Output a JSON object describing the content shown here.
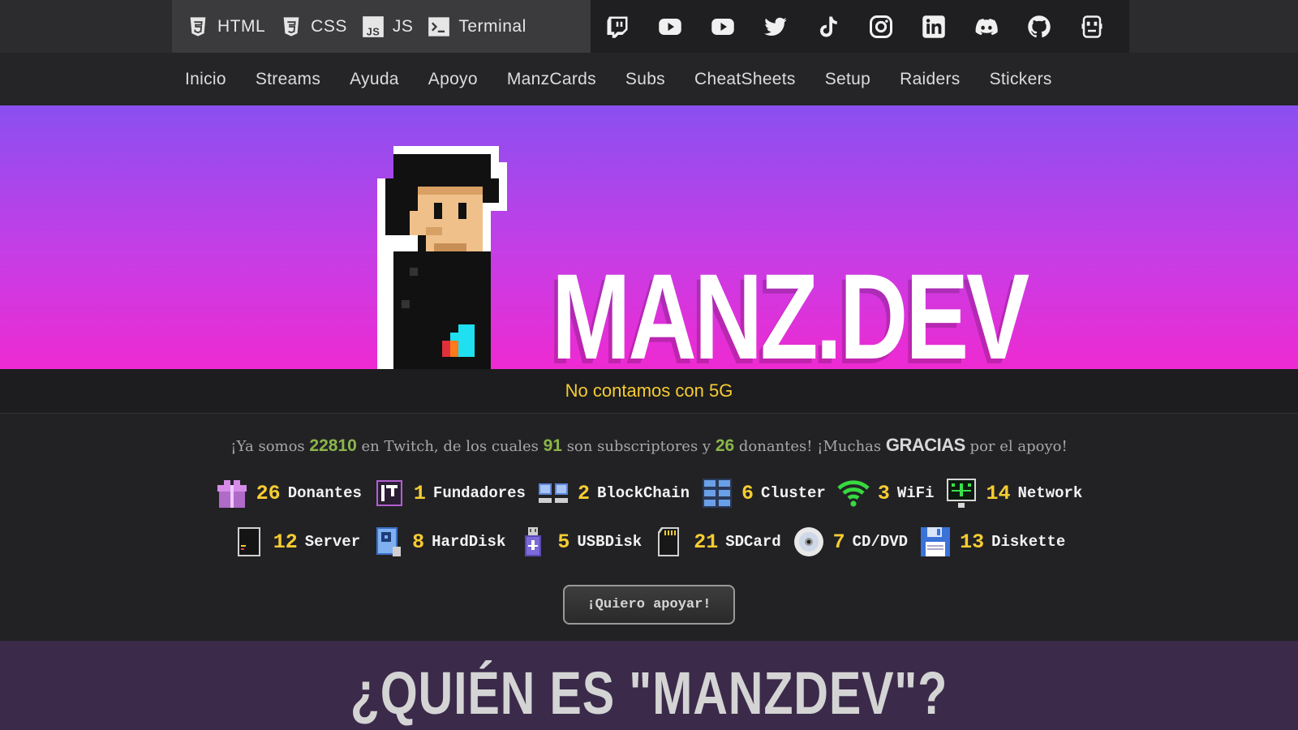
{
  "topbar": {
    "links": [
      {
        "label": "HTML",
        "icon": "html5-icon"
      },
      {
        "label": "CSS",
        "icon": "css3-icon"
      },
      {
        "label": "JS",
        "icon": "js-icon"
      },
      {
        "label": "Terminal",
        "icon": "terminal-icon"
      }
    ],
    "social": [
      "twitch-icon",
      "youtube-icon",
      "youtube-icon",
      "twitter-icon",
      "tiktok-icon",
      "instagram-icon",
      "linkedin-icon",
      "discord-icon",
      "github-icon",
      "manz-icon"
    ]
  },
  "nav": {
    "items": [
      "Inicio",
      "Streams",
      "Ayuda",
      "Apoyo",
      "ManzCards",
      "Subs",
      "CheatSheets",
      "Setup",
      "Raiders",
      "Stickers"
    ]
  },
  "hero": {
    "brand": "MANZ.DEV"
  },
  "banner": {
    "text": "No contamos con 5G"
  },
  "stats": {
    "p1": "¡Ya somos ",
    "followers": "22810",
    "p2": " en Twitch, de los cuales ",
    "subs": "91",
    "p3": " son subscriptores y ",
    "donors": "26",
    "p4": " donantes! ¡Muchas ",
    "thanks": "GRACIAS",
    "p5": " por el apoyo!"
  },
  "tiers_row1": [
    {
      "count": "26",
      "name": "Donantes",
      "icon": "gift-icon"
    },
    {
      "count": "1",
      "name": "Fundadores",
      "icon": "first-badge-icon"
    },
    {
      "count": "2",
      "name": "BlockChain",
      "icon": "blockchain-icon"
    },
    {
      "count": "6",
      "name": "Cluster",
      "icon": "cluster-icon"
    },
    {
      "count": "3",
      "name": "WiFi",
      "icon": "wifi-icon"
    },
    {
      "count": "14",
      "name": "Network",
      "icon": "network-icon"
    }
  ],
  "tiers_row2": [
    {
      "count": "12",
      "name": "Server",
      "icon": "server-icon"
    },
    {
      "count": "8",
      "name": "HardDisk",
      "icon": "harddisk-icon"
    },
    {
      "count": "5",
      "name": "USBDisk",
      "icon": "usb-icon"
    },
    {
      "count": "21",
      "name": "SDCard",
      "icon": "sdcard-icon"
    },
    {
      "count": "7",
      "name": "CD/DVD",
      "icon": "cd-icon"
    },
    {
      "count": "13",
      "name": "Diskette",
      "icon": "diskette-icon"
    }
  ],
  "support_button": "¡Quiero apoyar!",
  "who": {
    "title": "¿QUIÉN ES \"MANZDEV\"?"
  },
  "colors": {
    "accent_yellow": "#f6cc32",
    "accent_green": "#8bb64a",
    "hero_top": "#8a4ff0",
    "hero_bottom": "#ee2ad2"
  }
}
